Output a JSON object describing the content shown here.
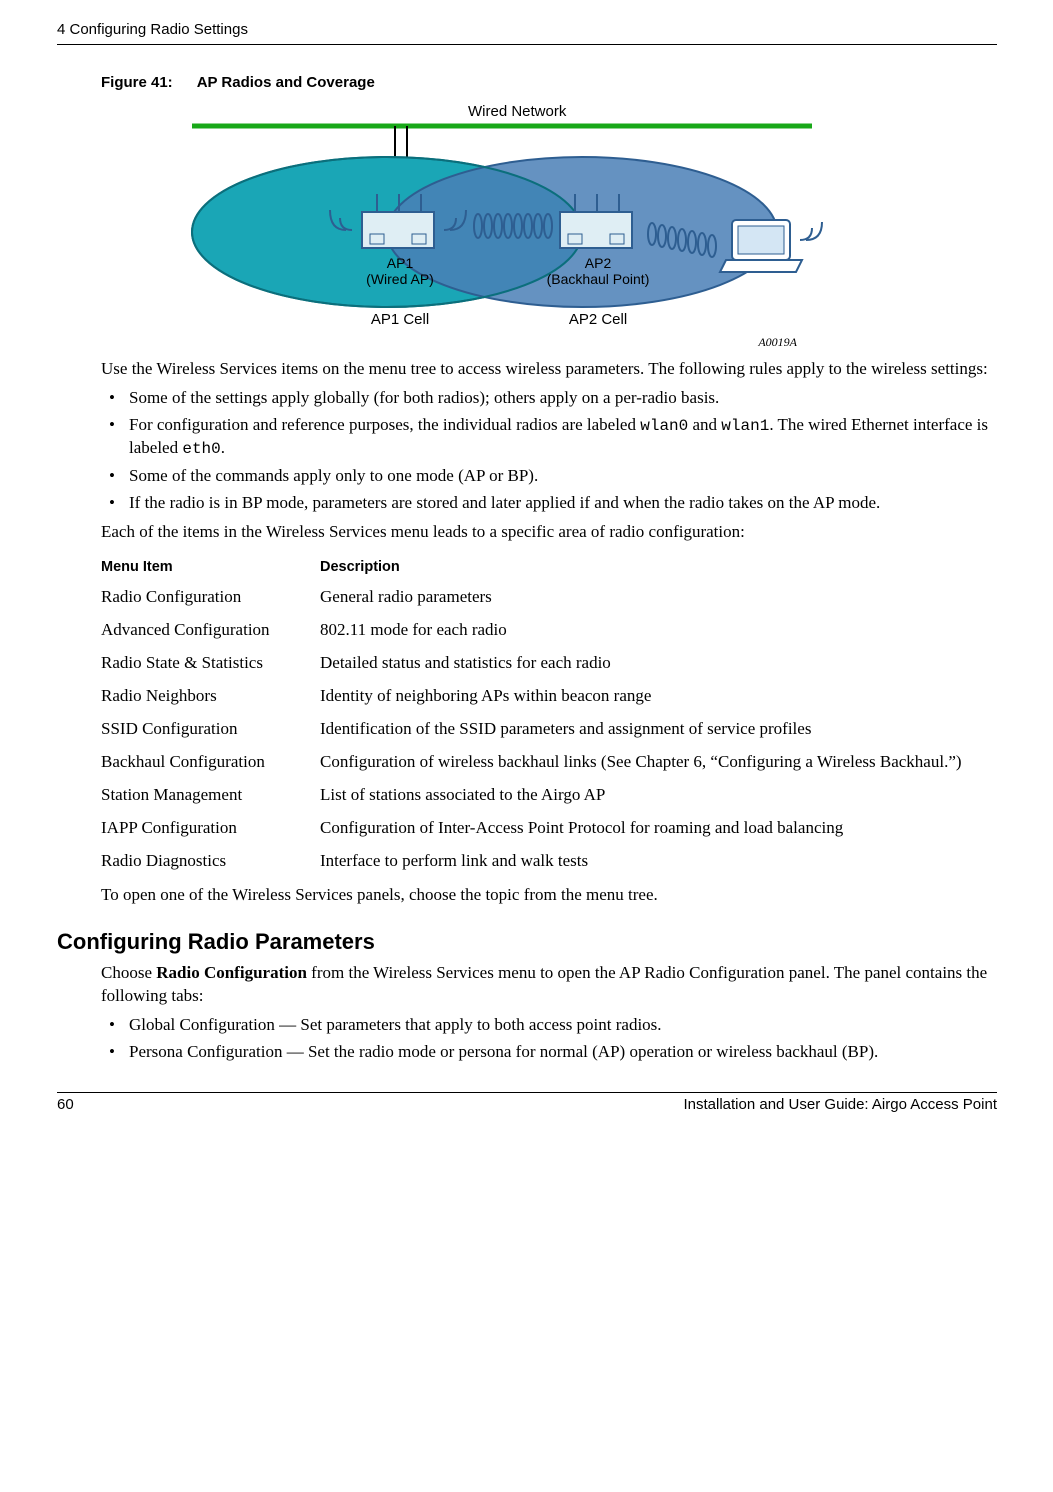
{
  "header": {
    "left": "4  Configuring Radio Settings"
  },
  "figure": {
    "label": "Figure 41:",
    "title": "AP Radios and Coverage",
    "wired_network": "Wired Network",
    "ap1": "AP1",
    "ap1_sub": "(Wired AP)",
    "ap2": "AP2",
    "ap2_sub": "(Backhaul Point)",
    "ap1_cell": "AP1 Cell",
    "ap2_cell": "AP2 Cell",
    "code": "A0019A"
  },
  "intro": "Use the Wireless Services items on the menu tree to access wireless parameters. The following rules apply to the wireless settings:",
  "rules": [
    {
      "text": "Some of the settings apply globally (for both radios); others apply on a per-radio basis."
    },
    {
      "pre": "For configuration and reference purposes, the individual radios are labeled ",
      "code1": "wlan0",
      "mid": " and ",
      "code2": "wlan1",
      "post": ". The wired Ethernet interface is labeled ",
      "code3": "eth0",
      "end": "."
    },
    {
      "text": "Some of the commands apply only to one mode (AP or BP)."
    },
    {
      "text": "If the radio is in BP mode, parameters are stored and later applied if and when the radio takes on the AP mode."
    }
  ],
  "lead_in": "Each of the items in the Wireless Services menu leads to a specific area of radio configuration:",
  "table": {
    "headers": [
      "Menu Item",
      "Description"
    ],
    "rows": [
      [
        "Radio Configuration",
        "General radio parameters"
      ],
      [
        "Advanced Configuration",
        "802.11 mode for each radio"
      ],
      [
        "Radio State & Statistics",
        "Detailed status and statistics for each radio"
      ],
      [
        "Radio Neighbors",
        "Identity of neighboring APs within beacon range"
      ],
      [
        "SSID Configuration",
        "Identification of the SSID parameters and assignment of service profiles"
      ],
      [
        "Backhaul Configuration",
        "Configuration of wireless backhaul links (See Chapter 6,  “Configuring a Wireless Backhaul.”)"
      ],
      [
        "Station Management",
        "List of stations associated to the Airgo AP"
      ],
      [
        "IAPP Configuration",
        "Configuration of Inter-Access Point Protocol for roaming and load balancing"
      ],
      [
        "Radio Diagnostics",
        "Interface to perform link and walk tests"
      ]
    ]
  },
  "open_panel": "To open one of the Wireless Services panels, choose the topic from the menu tree.",
  "section": {
    "title": "Configuring Radio Parameters",
    "intro_pre": "Choose ",
    "intro_bold": "Radio Configuration",
    "intro_post": " from the Wireless Services menu to open the AP Radio Configuration panel. The panel contains the following tabs:",
    "bullets": [
      "Global Configuration — Set parameters that apply to both access point radios.",
      "Persona Configuration — Set the radio mode or persona for normal (AP) operation or wireless backhaul (BP)."
    ]
  },
  "footer": {
    "left": "60",
    "right": "Installation and User Guide: Airgo Access Point"
  }
}
